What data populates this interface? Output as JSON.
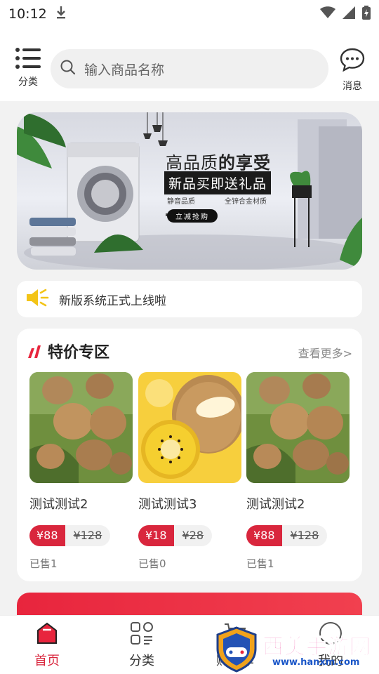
{
  "status": {
    "time": "10:12"
  },
  "header": {
    "menu_label": "分类",
    "search_placeholder": "输入商品名称",
    "message_label": "消息"
  },
  "banner": {
    "title_part1": "高品质",
    "title_part2": "的享受",
    "subtitle": "新品买即送礼品",
    "feature1": "静音品质",
    "feature2": "全锌合金材质",
    "button": "立减抢购"
  },
  "notice": {
    "text": "新版系统正式上线啦"
  },
  "special": {
    "title": "特价专区",
    "more": "查看更多>",
    "products": [
      {
        "name": "测试测试2",
        "price": "¥88",
        "old_price": "¥128",
        "sold": "已售1"
      },
      {
        "name": "测试测试3",
        "price": "¥18",
        "old_price": "¥28",
        "sold": "已售0"
      },
      {
        "name": "测试测试2",
        "price": "¥88",
        "old_price": "¥128",
        "sold": "已售1"
      }
    ]
  },
  "bottom_nav": {
    "items": [
      {
        "label": "首页",
        "active": true
      },
      {
        "label": "分类",
        "active": false
      },
      {
        "label": "购物车",
        "active": false
      },
      {
        "label": "我的",
        "active": false
      }
    ]
  },
  "watermark": {
    "name": "西美手游网",
    "url": "www.hanxm.com"
  },
  "colors": {
    "accent": "#d9263d",
    "background": "#f2f2f2"
  }
}
